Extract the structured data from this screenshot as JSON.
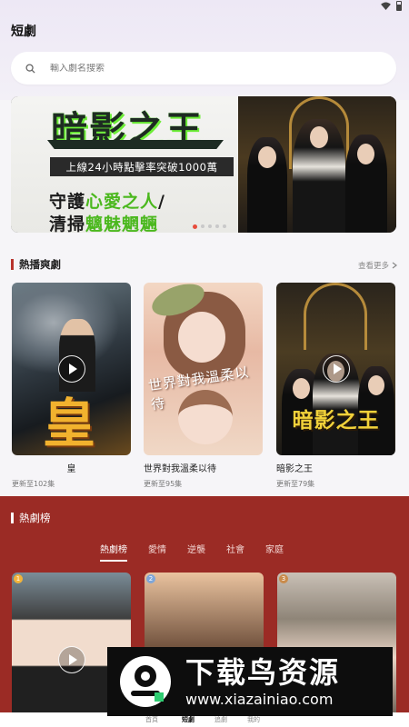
{
  "app": {
    "title": "短劇"
  },
  "search": {
    "placeholder": "輸入劇名搜索",
    "icon": "search-icon"
  },
  "banner": {
    "title_art": "暗影之王",
    "ribbon": "上線24小時點擊率突破1000萬",
    "line1_a": "守護",
    "line1_b": "心愛之人",
    "line1_c": "/",
    "line2_a": "清掃",
    "line2_b": "魑魅魍魎",
    "accent": "#4bb81e",
    "dot_count": 5,
    "active_dot": 0
  },
  "hot": {
    "title": "熱播爽劇",
    "more_label": "查看更多",
    "more_icon": "chevron-right-icon",
    "items": [
      {
        "title": "皇",
        "sub": "更新至102集",
        "poster_art": "皇"
      },
      {
        "title": "世界對我溫柔以待",
        "sub": "更新至95集",
        "poster_art": "世界對我溫柔以待"
      },
      {
        "title": "暗影之王",
        "sub": "更新至79集",
        "poster_art": "暗影之王"
      }
    ]
  },
  "ranking": {
    "title": "熱劇榜",
    "background": "#9b2b25",
    "tabs": [
      "熱劇榜",
      "愛情",
      "逆襲",
      "社會",
      "家庭"
    ],
    "active_tab": 0,
    "cards": [
      {
        "rank": "1"
      },
      {
        "rank": "2"
      },
      {
        "rank": "3"
      }
    ]
  },
  "watermark": {
    "main": "下载鸟资源",
    "url": "www.xiazainiao.com"
  },
  "bottom_nav": {
    "items": [
      "首頁",
      "短劇",
      "追劇",
      "我的"
    ],
    "active": 1
  }
}
